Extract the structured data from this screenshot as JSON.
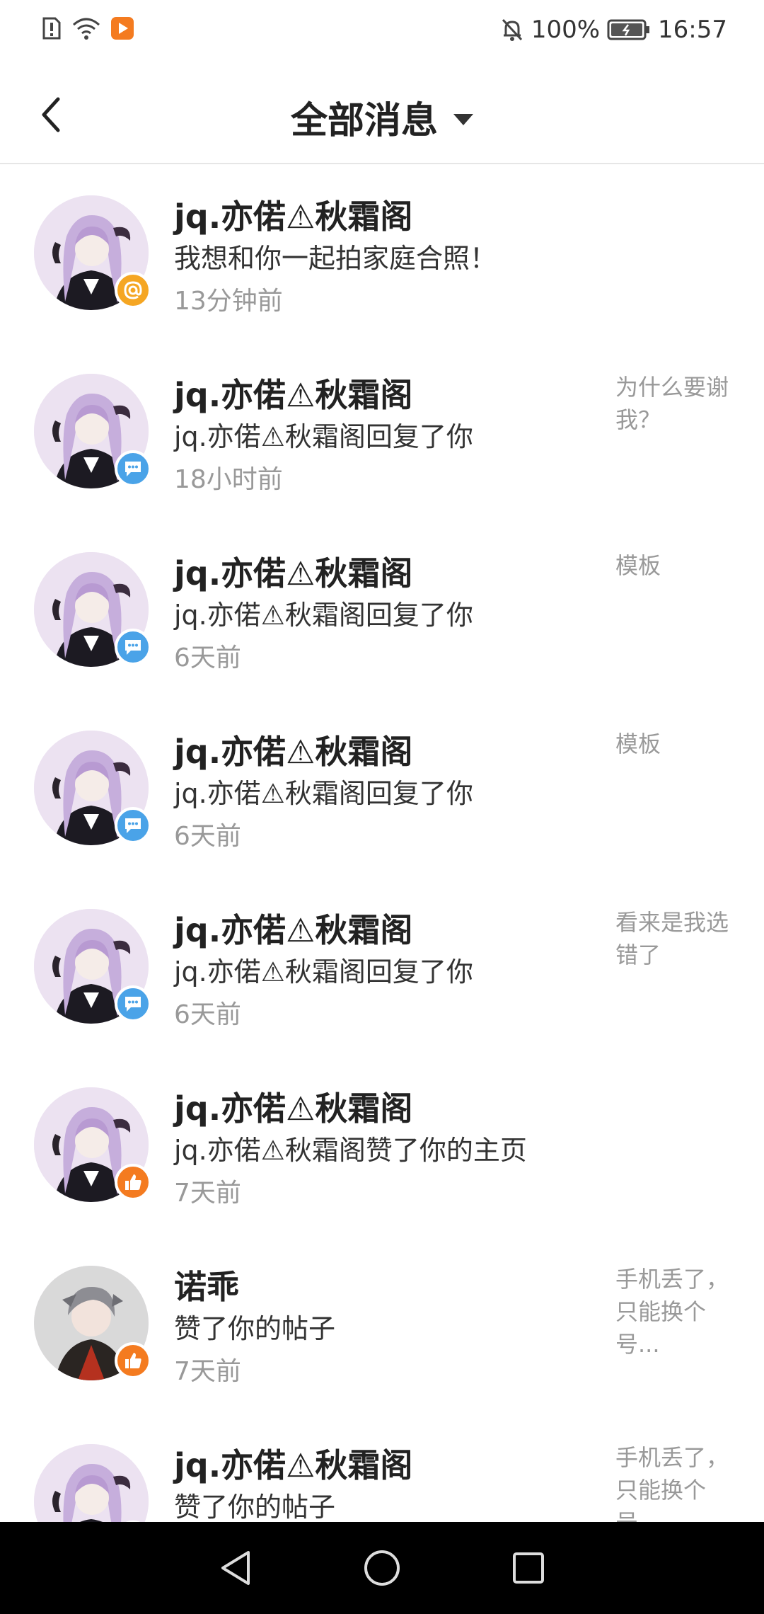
{
  "status_bar": {
    "battery": "100%",
    "time": "16:57",
    "left_icons": [
      "alert-sim-icon",
      "wifi-icon",
      "app-notification-icon"
    ],
    "right_icons": [
      "mute-bell-icon",
      "battery-icon"
    ]
  },
  "header": {
    "title": "全部消息"
  },
  "messages": [
    {
      "name": "jq.亦偌⚠秋霜阁",
      "text": "我想和你一起拍家庭合照！",
      "time": "13分钟前",
      "snippet": "",
      "badge": "mention",
      "avatar": "purple"
    },
    {
      "name": "jq.亦偌⚠秋霜阁",
      "text": "jq.亦偌⚠秋霜阁回复了你",
      "time": "18小时前",
      "snippet": "为什么要谢我？",
      "badge": "reply",
      "avatar": "purple"
    },
    {
      "name": "jq.亦偌⚠秋霜阁",
      "text": "jq.亦偌⚠秋霜阁回复了你",
      "time": "6天前",
      "snippet": "模板",
      "badge": "reply",
      "avatar": "purple"
    },
    {
      "name": "jq.亦偌⚠秋霜阁",
      "text": "jq.亦偌⚠秋霜阁回复了你",
      "time": "6天前",
      "snippet": "模板",
      "badge": "reply",
      "avatar": "purple"
    },
    {
      "name": "jq.亦偌⚠秋霜阁",
      "text": "jq.亦偌⚠秋霜阁回复了你",
      "time": "6天前",
      "snippet": "看来是我选错了",
      "badge": "reply",
      "avatar": "purple"
    },
    {
      "name": "jq.亦偌⚠秋霜阁",
      "text": "jq.亦偌⚠秋霜阁赞了你的主页",
      "time": "7天前",
      "snippet": "",
      "badge": "like",
      "avatar": "purple"
    },
    {
      "name": "诺乖",
      "text": "赞了你的帖子",
      "time": "7天前",
      "snippet": "手机丢了，只能换个号...",
      "badge": "like",
      "avatar": "gray"
    },
    {
      "name": "jq.亦偌⚠秋霜阁",
      "text": "赞了你的帖子",
      "time": "",
      "snippet": "手机丢了，只能换个号...",
      "badge": "like",
      "avatar": "purple"
    }
  ],
  "colors": {
    "mention_badge": "#f5a623",
    "reply_badge": "#4aa3e8",
    "like_badge": "#f47b20",
    "nav_bar": "#000000"
  },
  "nav": {
    "icons": [
      "back-triangle-icon",
      "home-circle-icon",
      "recents-square-icon"
    ]
  }
}
